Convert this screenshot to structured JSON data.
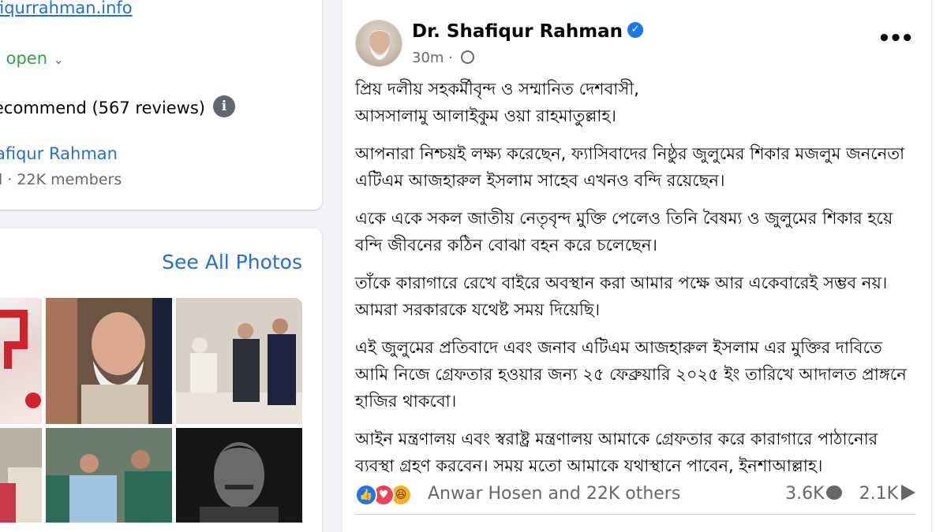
{
  "intro": {
    "website": "fiqurrahman.info",
    "hours": "s open",
    "hours_chevron": "⌄",
    "recommend": "ecommend (567 reviews)",
    "info_glyph": "i",
    "group_name": "afiqur Rahman",
    "group_meta": "l · 22K members"
  },
  "photos": {
    "see_all": "See All Photos"
  },
  "post": {
    "author": "Dr. Shafiqur Rahman",
    "verified_glyph": "✓",
    "time": "30m · ",
    "more_glyph": "•••",
    "paragraphs": [
      "প্রিয় দলীয় সহকর্মীবৃন্দ ও সম্মানিত দেশবাসী,\nআসসালামু আলাইকুম ওয়া রাহমাতুল্লাহ।",
      "আপনারা নিশ্চয়ই লক্ষ্য করেছেন, ফ্যাসিবাদের নিষ্ঠুর জুলুমের শিকার মজলুম জননেতা এটিএম আজহারুল ইসলাম সাহেব এখনও বন্দি রয়েছেন।",
      "একে একে সকল জাতীয় নেতৃবৃন্দ মুক্তি পেলেও তিনি বৈষম্য ও জুলুমের শিকার হয়ে বন্দি জীবনের কঠিন বোঝা বহন করে চলেছেন।",
      "তাঁকে কারাগারে রেখে বাইরে অবস্থান করা আমার পক্ষে আর একেবারেই সম্ভব নয়। আমরা সরকারকে যথেষ্ট সময় দিয়েছি।",
      "এই জুলুমের প্রতিবাদে এবং জনাব এটিএম আজহারুল ইসলাম এর মুক্তির দাবিতে আমি নিজে গ্রেফতার হওয়ার জন্য ২৫ ফেব্রুয়ারি ২০২৫ ইং তারিখে আদালত প্রাঙ্গনে হাজির থাকবো।",
      "আইন মন্ত্রণালয় এবং স্বরাষ্ট্র মন্ত্রণালয় আমাকে গ্রেফতার করে কারাগারে পাঠানোর ব্যবস্থা গ্রহণ করবেন। সময় মতো আমাকে যথাস্থানে পাবেন, ইনশাআল্লাহ।"
    ],
    "reactions": {
      "like_glyph": "👍",
      "love_glyph": "♥",
      "haha_glyph": "😆",
      "reacted_by": "Anwar Hosen and 22K others",
      "comments": "3.6K",
      "shares": "2.1K"
    }
  },
  "colors": {
    "link": "#216fdb",
    "open": "#31a24c",
    "secondary_text": "#65676b",
    "verified": "#1877f2",
    "page_bg": "#f0f2f5"
  }
}
